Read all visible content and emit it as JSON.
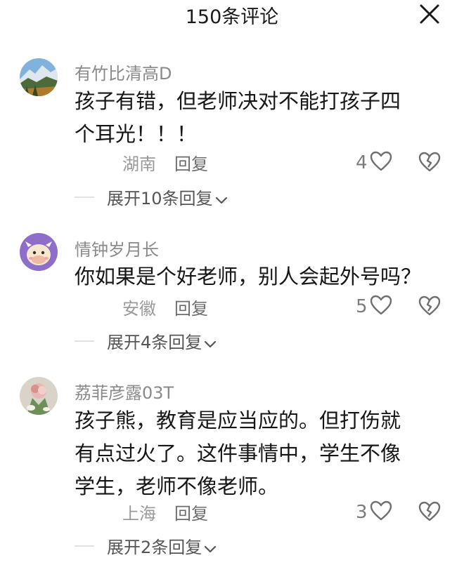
{
  "header": {
    "title": "150条评论"
  },
  "icons": {
    "close": "close-icon",
    "like": "heart-outline-icon",
    "dislike": "broken-heart-icon",
    "expand": "chevron-down-icon"
  },
  "comments": [
    {
      "username": "有竹比清高D",
      "lines": [
        "孩子有错，但老师决对不能打孩子四",
        "个耳光！！！"
      ],
      "location": "湖南",
      "reply": "回复",
      "likes": "4",
      "expand": "展开10条回复"
    },
    {
      "username": "情钟岁月长",
      "lines": [
        "你如果是个好老师，别人会起外号吗？"
      ],
      "location": "安徽",
      "reply": "回复",
      "likes": "5",
      "expand": "展开4条回复"
    },
    {
      "username": "荔菲彦露03T",
      "lines": [
        "孩子熊，教育是应当应的。但打伤就",
        "有点过火了。这件事情中，学生不像",
        "学生，老师不像老师。"
      ],
      "location": "上海",
      "reply": "回复",
      "likes": "3",
      "expand": "展开2条回复"
    }
  ]
}
